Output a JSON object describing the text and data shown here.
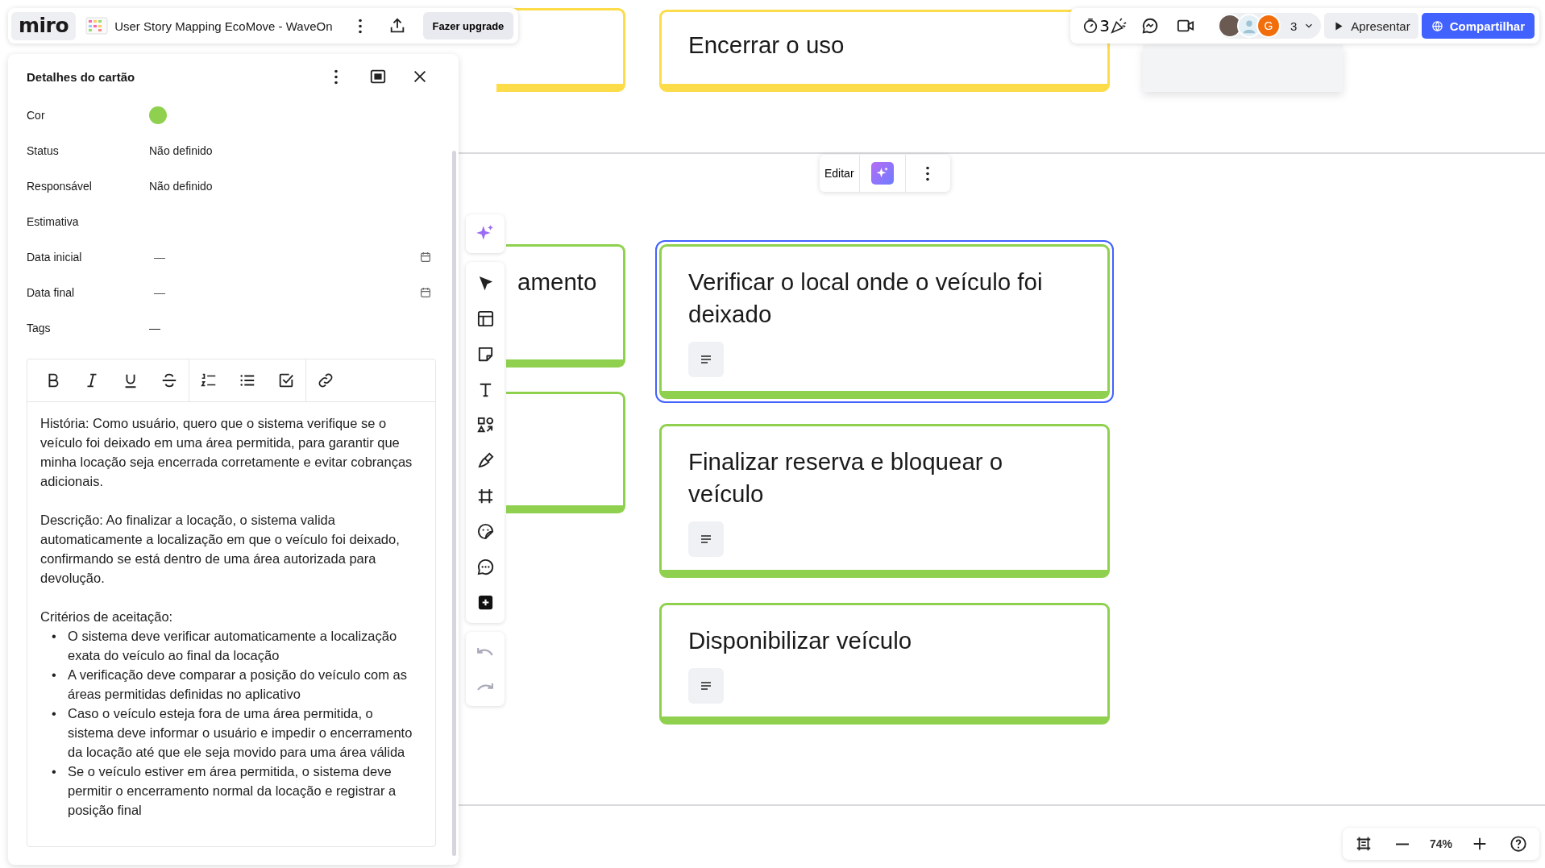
{
  "toolbar": {
    "logo": "miro",
    "board_title": "User Story Mapping EcoMove - WaveOn",
    "upgrade_button": "Fazer upgrade"
  },
  "top_right": {
    "timer_count": "3",
    "avatars": [
      {
        "kind": "photo"
      },
      {
        "kind": "silhouette"
      },
      {
        "kind": "initial",
        "label": "G"
      }
    ],
    "participant_count": "3",
    "present_button": "Apresentar",
    "share_button": "Compartilhar"
  },
  "card_details": {
    "title": "Detalhes do cartão",
    "fields": [
      {
        "label": "Cor",
        "kind": "color",
        "color": "#8fd14f"
      },
      {
        "label": "Status",
        "kind": "text",
        "value": "Não definido"
      },
      {
        "label": "Responsável",
        "kind": "text",
        "value": "Não definido"
      },
      {
        "label": "Estimativa",
        "kind": "text"
      },
      {
        "label": "Data inicial",
        "kind": "date",
        "value": "—"
      },
      {
        "label": "Data final",
        "kind": "date",
        "value": "—"
      },
      {
        "label": "Tags",
        "kind": "text",
        "value": "—"
      }
    ],
    "paragraphs": [
      "História: Como usuário, quero que o sistema verifique se o veículo foi deixado em uma área permitida, para garantir que minha locação seja encerrada corretamente e evitar cobranças adicionais.",
      "Descrição: Ao finalizar a locação, o sistema valida automaticamente a localização em que o veículo foi deixado, confirmando se está dentro de uma área autorizada para devolução."
    ],
    "criteria_title": "Critérios de aceitação:",
    "criteria": [
      {
        "bullet": "•",
        "text": "O sistema deve verificar automaticamente a localização exata do veículo ao final da locação"
      },
      {
        "bullet": "•",
        "text": "A verificação deve comparar a posição do veículo com as áreas permitidas definidas no aplicativo"
      },
      {
        "bullet": "•",
        "text": "Caso o veículo esteja fora de uma área permitida, o sistema deve informar o usuário e impedir o encerramento da locação até que ele seja movido para uma área válida"
      },
      {
        "bullet": "•",
        "text": "Se o veículo estiver em área permitida, o sistema deve permitir o encerramento normal da locação e registrar a posição final"
      }
    ]
  },
  "canvas": {
    "cards": [
      {
        "color": "#fddc4a",
        "selected": false,
        "has_notes": false
      },
      {
        "text": "Encerrar o uso",
        "color": "#fddc4a",
        "selected": false,
        "has_notes": false
      },
      {
        "text": "amento",
        "color": "#8fd14f",
        "selected": false,
        "has_notes": false
      },
      {
        "color": "#8fd14f",
        "selected": false,
        "has_notes": false
      },
      {
        "text": "Verificar o local onde o veículo foi deixado",
        "color": "#8fd14f",
        "selected": true,
        "has_notes": true
      },
      {
        "text": "Finalizar reserva e bloquear o veículo",
        "color": "#8fd14f",
        "selected": false,
        "has_notes": true
      },
      {
        "text": "Disponibilizar veículo",
        "color": "#8fd14f",
        "selected": false,
        "has_notes": true
      }
    ],
    "context_menu": {
      "edit_button": "Editar"
    }
  },
  "zoom_controls": {
    "zoom_level": "74%"
  }
}
